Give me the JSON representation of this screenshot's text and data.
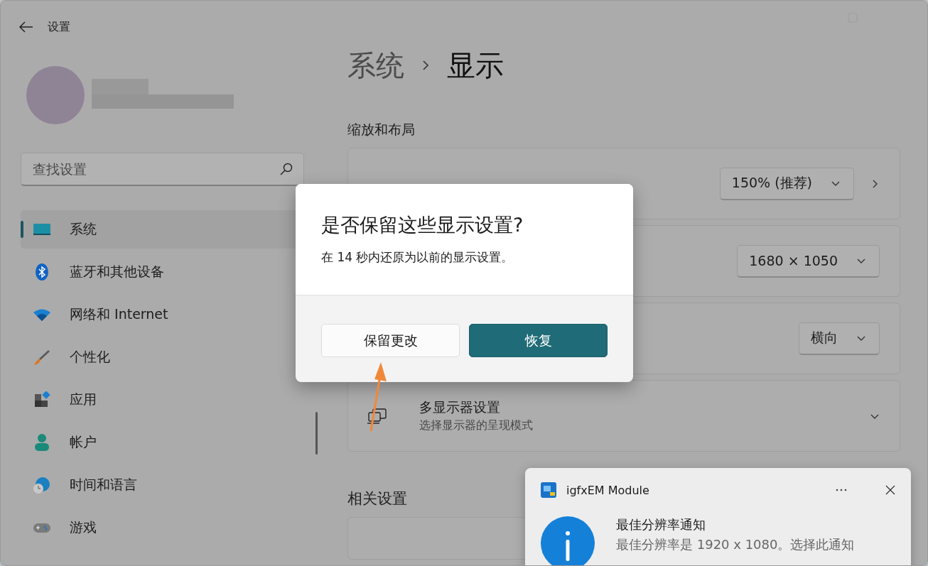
{
  "window": {
    "title": "设置"
  },
  "sidebar": {
    "search": {
      "placeholder": "查找设置"
    },
    "items": [
      {
        "label": "系统",
        "selected": true
      },
      {
        "label": "蓝牙和其他设备",
        "selected": false
      },
      {
        "label": "网络和 Internet",
        "selected": false
      },
      {
        "label": "个性化",
        "selected": false
      },
      {
        "label": "应用",
        "selected": false
      },
      {
        "label": "帐户",
        "selected": false
      },
      {
        "label": "时间和语言",
        "selected": false
      },
      {
        "label": "游戏",
        "selected": false
      }
    ]
  },
  "main": {
    "breadcrumb": {
      "parent": "系统",
      "current": "显示"
    },
    "section": "缩放和布局",
    "cards": [
      {
        "kind": "dropdown",
        "value": "150% (推荐)",
        "link": true
      },
      {
        "kind": "dropdown",
        "value": "1680 × 1050",
        "link": false
      },
      {
        "kind": "dropdown",
        "value": "横向",
        "link": false
      },
      {
        "kind": "expander",
        "title": "多显示器设置",
        "subtitle": "选择显示器的呈现模式"
      }
    ],
    "related": "相关设置"
  },
  "dialog": {
    "title": "是否保留这些显示设置?",
    "body": "在 14 秒内还原为以前的显示设置。",
    "buttons": [
      {
        "label": "保留更改",
        "primary": false
      },
      {
        "label": "恢复",
        "primary": true
      }
    ]
  },
  "toast": {
    "app": "igfxEM Module",
    "title": "最佳分辨率通知",
    "body": "最佳分辨率是 1920 x 1080。选择此通知"
  }
}
